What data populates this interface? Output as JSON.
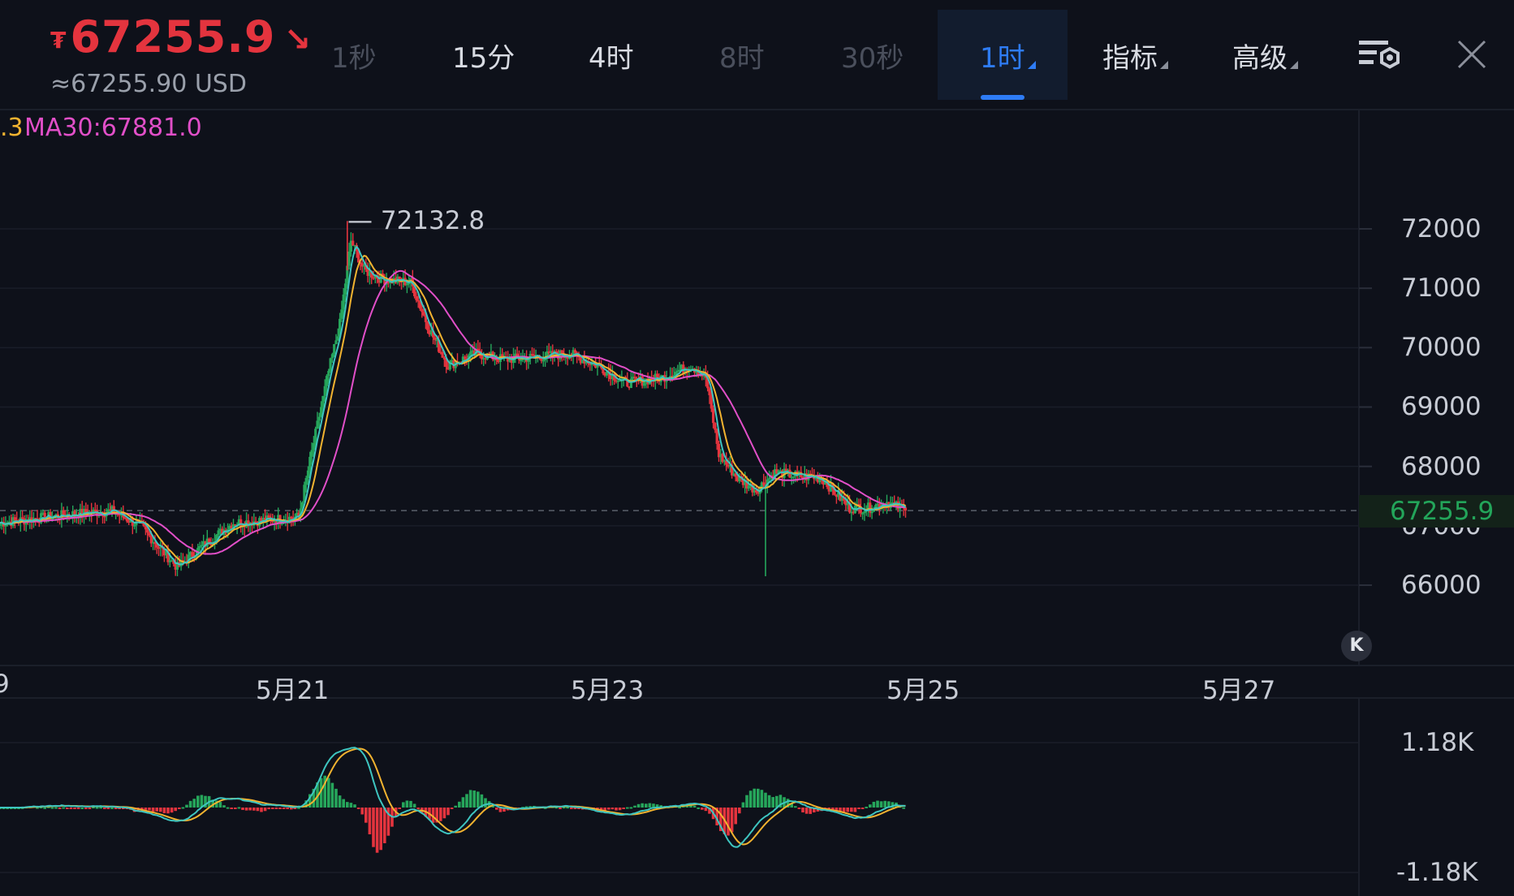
{
  "header": {
    "currency_icon": "tether-icon",
    "price": "67255.9",
    "trend_icon": "arrow-down-right-icon",
    "usd_value": "≈67255.90 USD"
  },
  "tabs": [
    {
      "label": "1秒",
      "state": "dim"
    },
    {
      "label": "15分",
      "state": "normal"
    },
    {
      "label": "4时",
      "state": "normal"
    },
    {
      "label": "8时",
      "state": "dim"
    },
    {
      "label": "30秒",
      "state": "dim"
    },
    {
      "label": "1时",
      "state": "active"
    },
    {
      "label": "指标",
      "state": "normal"
    },
    {
      "label": "高级",
      "state": "normal"
    }
  ],
  "icons": {
    "settings": "chart-settings-icon",
    "close": "close-icon",
    "back": "scroll-to-latest-icon"
  },
  "ma_legend": {
    "partial": ".3",
    "ma30": "MA30:67881.0"
  },
  "colors": {
    "up": "#26a65b",
    "down": "#e4343e",
    "ma_fast": "#3ec5c0",
    "ma_mid": "#f2b330",
    "ma30": "#e14fc8",
    "accent": "#2e7cf6",
    "background": "#0e111a"
  },
  "price_badge": "67255.9",
  "high_label": "72132.8",
  "chart_data": {
    "type": "candlestick",
    "interval": "1h",
    "y_axis": {
      "labels": [
        "72000",
        "71000",
        "70000",
        "69000",
        "68000",
        "67000",
        "66000"
      ],
      "range": [
        65000,
        73500
      ]
    },
    "x_axis": {
      "labels": [
        "9",
        "5月21",
        "5月23",
        "5月25",
        "5月27"
      ]
    },
    "current_price": 67255.9,
    "high": 72132.8,
    "ma_series": [
      {
        "name": "MA30",
        "value": 67881.0,
        "color": "#e14fc8"
      }
    ],
    "macd_panel": {
      "labels": [
        "1.18K",
        "-1.18K"
      ],
      "range": [
        -1180,
        1180
      ]
    },
    "key_closes": [
      {
        "t": 0,
        "p": 67050
      },
      {
        "t": 40,
        "p": 67200
      },
      {
        "t": 60,
        "p": 67250
      },
      {
        "t": 75,
        "p": 67000
      },
      {
        "t": 95,
        "p": 66300
      },
      {
        "t": 110,
        "p": 66700
      },
      {
        "t": 125,
        "p": 67050
      },
      {
        "t": 145,
        "p": 67100
      },
      {
        "t": 160,
        "p": 67150
      },
      {
        "t": 168,
        "p": 68400
      },
      {
        "t": 176,
        "p": 69600
      },
      {
        "t": 182,
        "p": 70400
      },
      {
        "t": 188,
        "p": 71800
      },
      {
        "t": 195,
        "p": 71300
      },
      {
        "t": 205,
        "p": 71150
      },
      {
        "t": 220,
        "p": 71100
      },
      {
        "t": 230,
        "p": 70300
      },
      {
        "t": 240,
        "p": 69700
      },
      {
        "t": 255,
        "p": 69900
      },
      {
        "t": 270,
        "p": 69800
      },
      {
        "t": 290,
        "p": 69850
      },
      {
        "t": 305,
        "p": 69900
      },
      {
        "t": 320,
        "p": 69700
      },
      {
        "t": 335,
        "p": 69400
      },
      {
        "t": 355,
        "p": 69500
      },
      {
        "t": 370,
        "p": 69700
      },
      {
        "t": 378,
        "p": 69500
      },
      {
        "t": 385,
        "p": 68200
      },
      {
        "t": 395,
        "p": 67800
      },
      {
        "t": 405,
        "p": 67600
      },
      {
        "t": 415,
        "p": 67900
      },
      {
        "t": 425,
        "p": 67850
      },
      {
        "t": 440,
        "p": 67800
      },
      {
        "t": 455,
        "p": 67300
      },
      {
        "t": 465,
        "p": 67300
      },
      {
        "t": 475,
        "p": 67400
      },
      {
        "t": 485,
        "p": 67256
      }
    ]
  }
}
